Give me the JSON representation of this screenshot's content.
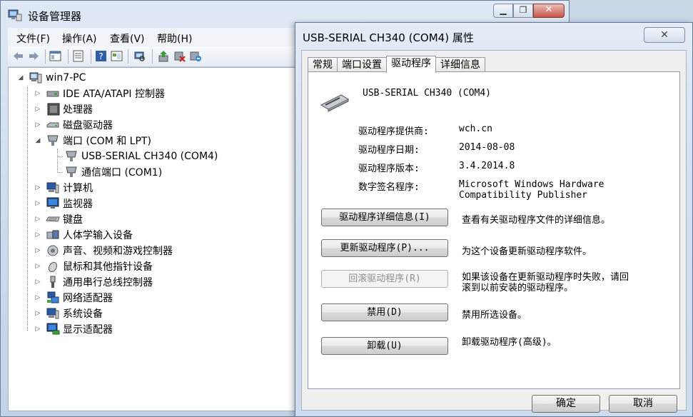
{
  "main_window": {
    "title": "设备管理器",
    "menu": [
      "文件(F)",
      "操作(A)",
      "查看(V)",
      "帮助(H)"
    ],
    "toolbar_icons": [
      "back-arrow-icon",
      "forward-arrow-icon",
      "show-hide-tree-icon",
      "properties-icon",
      "help-icon",
      "view-icon",
      "scan-hardware-icon",
      "update-driver-icon",
      "disable-device-icon",
      "uninstall-device-icon"
    ]
  },
  "tree": {
    "root": "win7-PC",
    "items": [
      {
        "label": "IDE ATA/ATAPI 控制器",
        "icon": "ide-controller-icon",
        "expanded": false
      },
      {
        "label": "处理器",
        "icon": "processor-icon",
        "expanded": false
      },
      {
        "label": "磁盘驱动器",
        "icon": "disk-drive-icon",
        "expanded": false
      },
      {
        "label": "端口 (COM 和 LPT)",
        "icon": "port-icon",
        "expanded": true,
        "children": [
          "USB-SERIAL CH340 (COM4)",
          "通信端口 (COM1)"
        ]
      },
      {
        "label": "计算机",
        "icon": "computer-icon",
        "expanded": false
      },
      {
        "label": "监视器",
        "icon": "monitor-icon",
        "expanded": false
      },
      {
        "label": "键盘",
        "icon": "keyboard-icon",
        "expanded": false
      },
      {
        "label": "人体学输入设备",
        "icon": "hid-icon",
        "expanded": false
      },
      {
        "label": "声音、视频和游戏控制器",
        "icon": "sound-icon",
        "expanded": false
      },
      {
        "label": "鼠标和其他指针设备",
        "icon": "mouse-icon",
        "expanded": false
      },
      {
        "label": "通用串行总线控制器",
        "icon": "usb-icon",
        "expanded": false
      },
      {
        "label": "网络适配器",
        "icon": "network-icon",
        "expanded": false
      },
      {
        "label": "系统设备",
        "icon": "system-device-icon",
        "expanded": false
      },
      {
        "label": "显示适配器",
        "icon": "display-adapter-icon",
        "expanded": false
      }
    ]
  },
  "dialog": {
    "title": "USB-SERIAL CH340 (COM4) 属性",
    "close_glyph": "✕",
    "tabs": [
      "常规",
      "端口设置",
      "驱动程序",
      "详细信息"
    ],
    "active_tab": 2,
    "device_name": "USB-SERIAL CH340 (COM4)",
    "info": [
      {
        "label": "驱动程序提供商:",
        "value": "wch.cn"
      },
      {
        "label": "驱动程序日期:",
        "value": "2014-08-08"
      },
      {
        "label": "驱动程序版本:",
        "value": "3.4.2014.8"
      },
      {
        "label": "数字签名程序:",
        "value": "Microsoft Windows Hardware",
        "value2": "Compatibility Publisher"
      }
    ],
    "actions": [
      {
        "button": "驱动程序详细信息(I)",
        "desc": "查看有关驱动程序文件的详细信息。",
        "enabled": true
      },
      {
        "button": "更新驱动程序(P)...",
        "desc": "为这个设备更新驱动程序软件。",
        "enabled": true
      },
      {
        "button": "回滚驱动程序(R)",
        "desc": "如果该设备在更新驱动程序时失败，请回",
        "desc2": "滚到以前安装的驱动程序。",
        "enabled": false
      },
      {
        "button": "禁用(D)",
        "desc": "禁用所选设备。",
        "enabled": true
      },
      {
        "button": "卸载(U)",
        "desc": "卸载驱动程序(高级)。",
        "enabled": true
      }
    ],
    "ok_label": "确定",
    "cancel_label": "取消"
  }
}
